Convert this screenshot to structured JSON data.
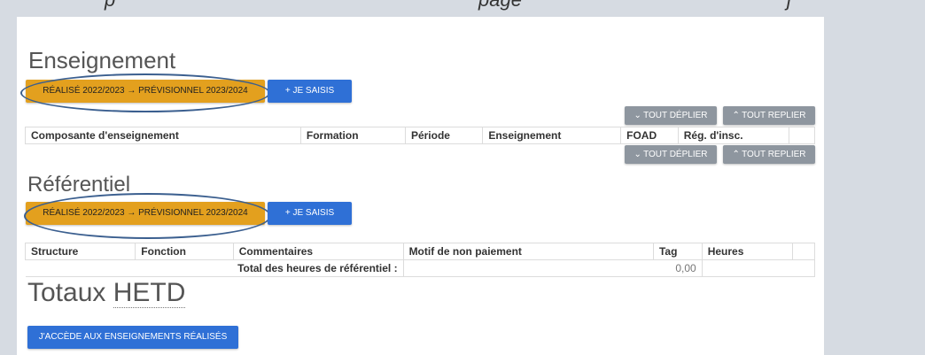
{
  "top_caption": "p                                                    page                    j",
  "sections": {
    "enseignement": {
      "title": "Enseignement",
      "realise_button": "RÉALISÉ 2022/2023 → PRÉVISIONNEL 2023/2024",
      "saisis_button": "+ JE SAISIS",
      "tout_deplier": "TOUT DÉPLIER",
      "tout_replier": "TOUT REPLIER",
      "columns": [
        "Composante d'enseignement",
        "Formation",
        "Période",
        "Enseignement",
        "FOAD",
        "Rég. d'insc.",
        ""
      ]
    },
    "referentiel": {
      "title": "Référentiel",
      "realise_button": "RÉALISÉ 2022/2023 → PRÉVISIONNEL 2023/2024",
      "saisis_button": "+ JE SAISIS",
      "tout_deplier": "TOUT DÉPLIER",
      "tout_replier": "TOUT REPLIER",
      "columns": [
        "Structure",
        "Fonction",
        "Commentaires",
        "Motif de non paiement",
        "Tag",
        "Heures",
        ""
      ],
      "total_label": "Total des heures de référentiel :",
      "total_value": "0,00"
    },
    "totaux": {
      "title_prefix": "Totaux ",
      "title_abbr": "HETD",
      "access_button": "J'ACCÈDE AUX ENSEIGNEMENTS RÉALISÉS"
    }
  },
  "colors": {
    "orange": "#e3a01e",
    "blue": "#2f70d6",
    "grey": "#8e969f",
    "ellipse": "#3b5f8f"
  },
  "icons": [
    "chevron-down-icon",
    "chevron-up-icon"
  ]
}
